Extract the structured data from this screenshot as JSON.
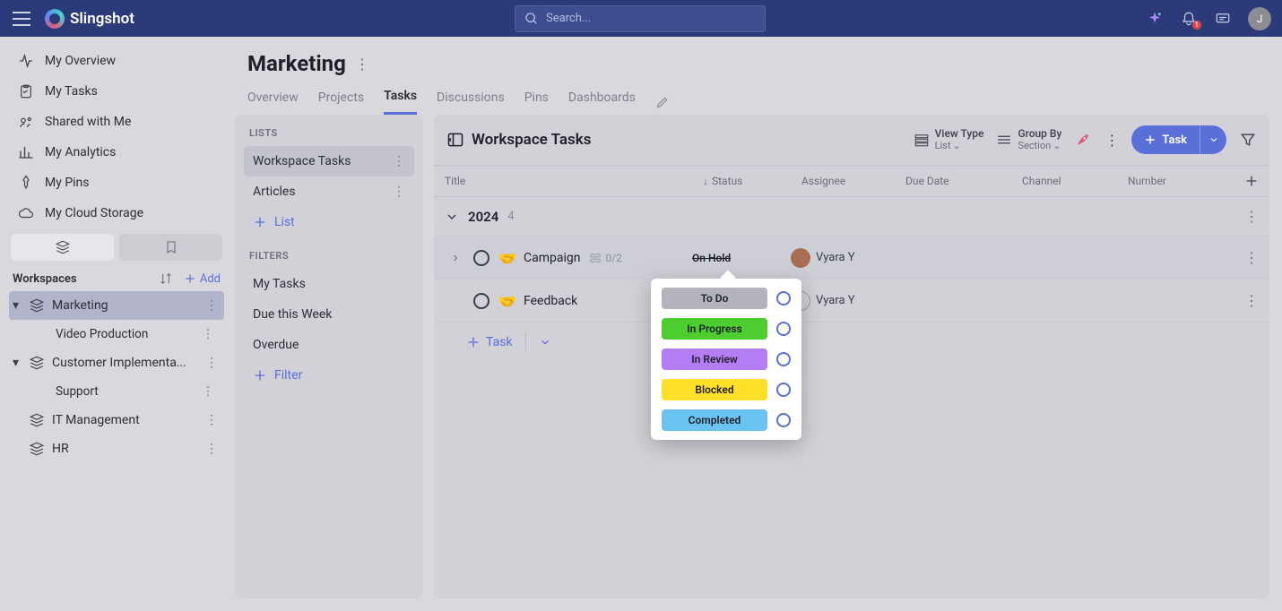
{
  "app_name": "Slingshot",
  "avatar_initial": "J",
  "notification_count": "1",
  "search_placeholder": "Search...",
  "sidebar_nav": [
    {
      "label": "My Overview"
    },
    {
      "label": "My Tasks"
    },
    {
      "label": "Shared with Me"
    },
    {
      "label": "My Analytics"
    },
    {
      "label": "My Pins"
    },
    {
      "label": "My Cloud Storage"
    }
  ],
  "workspaces_label": "Workspaces",
  "add_label": "Add",
  "workspaces": [
    {
      "name": "Marketing",
      "children": [
        "Video Production"
      ]
    },
    {
      "name": "Customer Implementa...",
      "children": [
        "Support"
      ]
    },
    {
      "name": "IT Management",
      "children": []
    },
    {
      "name": "HR",
      "children": []
    }
  ],
  "page_title": "Marketing",
  "tabs": [
    "Overview",
    "Projects",
    "Tasks",
    "Discussions",
    "Pins",
    "Dashboards"
  ],
  "active_tab": "Tasks",
  "lists_label": "LISTS",
  "lists": [
    "Workspace Tasks",
    "Articles"
  ],
  "active_list": "Workspace Tasks",
  "add_list_label": "List",
  "filters_label": "FILTERS",
  "filters": [
    "My Tasks",
    "Due this Week",
    "Overdue"
  ],
  "add_filter_label": "Filter",
  "tasks_title": "Workspace Tasks",
  "view_type": {
    "label": "View Type",
    "value": "List"
  },
  "group_by": {
    "label": "Group By",
    "value": "Section"
  },
  "task_button": "Task",
  "columns": [
    "Title",
    "Status",
    "Assignee",
    "Due Date",
    "Channel",
    "Number"
  ],
  "section": {
    "name": "2024",
    "count": "4"
  },
  "tasks": [
    {
      "name": "Campaign",
      "subtasks": "0/2",
      "status": "On Hold",
      "assignee": "Vyara Y",
      "has_sub": true
    },
    {
      "name": "Feedback",
      "status": "",
      "assignee": "Vyara Y",
      "has_sub": false
    }
  ],
  "add_task_label": "Task",
  "status_options": [
    {
      "label": "To Do",
      "color": "#b2b3bb"
    },
    {
      "label": "In Progress",
      "color": "#4cce2f"
    },
    {
      "label": "In Review",
      "color": "#b47df4"
    },
    {
      "label": "Blocked",
      "color": "#ffe028"
    },
    {
      "label": "Completed",
      "color": "#6ac3f1"
    }
  ]
}
